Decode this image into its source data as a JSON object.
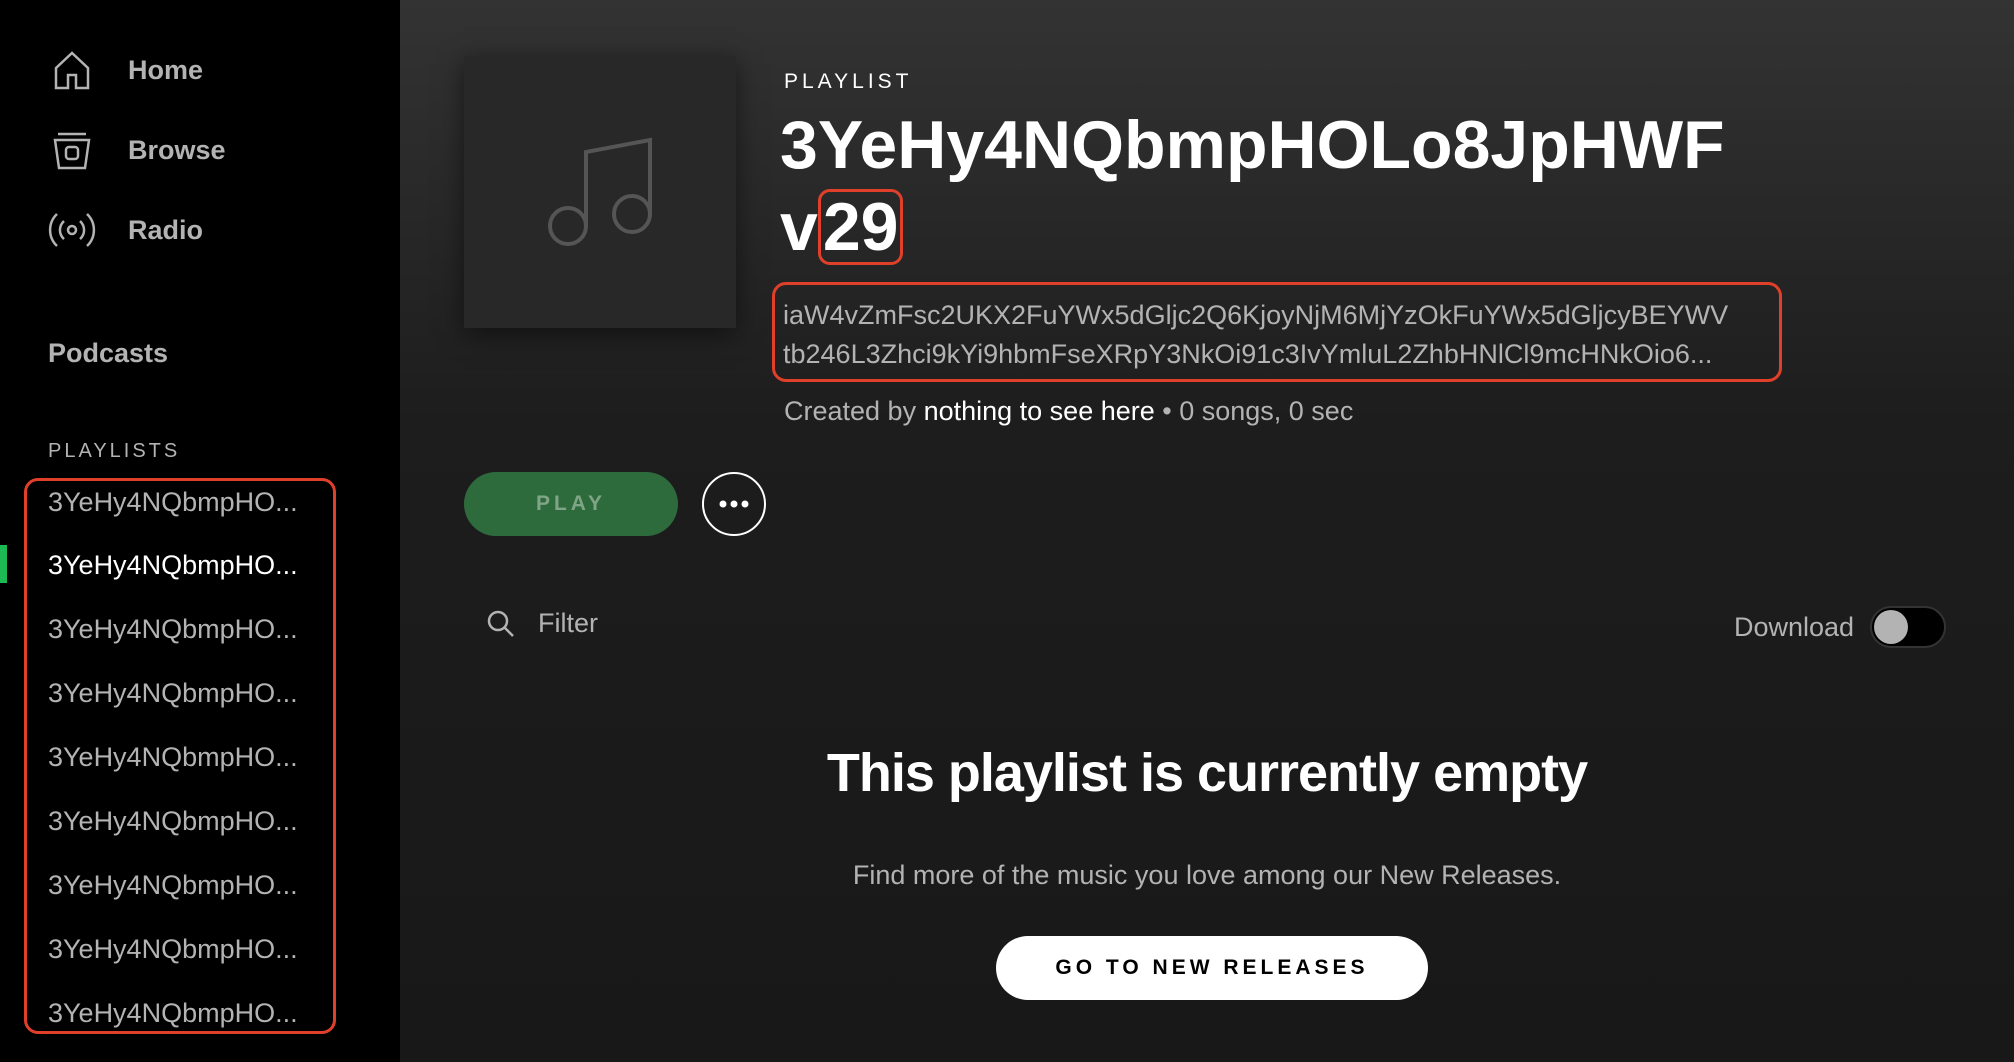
{
  "sidebar": {
    "nav": [
      {
        "label": "Home",
        "icon": "home-icon"
      },
      {
        "label": "Browse",
        "icon": "browse-icon"
      },
      {
        "label": "Radio",
        "icon": "radio-icon"
      }
    ],
    "podcasts_label": "Podcasts",
    "playlists_header": "PLAYLISTS",
    "playlists": [
      {
        "label": "3YeHy4NQbmpHO..."
      },
      {
        "label": "3YeHy4NQbmpHO..."
      },
      {
        "label": "3YeHy4NQbmpHO..."
      },
      {
        "label": "3YeHy4NQbmpHO..."
      },
      {
        "label": "3YeHy4NQbmpHO..."
      },
      {
        "label": "3YeHy4NQbmpHO..."
      },
      {
        "label": "3YeHy4NQbmpHO..."
      },
      {
        "label": "3YeHy4NQbmpHO..."
      },
      {
        "label": "3YeHy4NQbmpHO..."
      }
    ],
    "active_playlist_index": 1
  },
  "header": {
    "type_label": "PLAYLIST",
    "title_line1": "3YeHy4NQbmpHOLo8JpHWF",
    "title_prefix": "v",
    "title_version": "29",
    "description_line1": "iaW4vZmFsc2UKX2FuYWx5dGljc2Q6KjoyNjM6MjYzOkFuYWx5dGljcyBEYWV",
    "description_line2": "tb246L3Zhci9kYi9hbmFseXRpY3NkOi91c3IvYmluL2ZhbHNlCl9mcHNkOio6...",
    "meta_prefix": "Created by ",
    "meta_owner": "nothing to see here",
    "meta_suffix": " • 0 songs, 0 sec"
  },
  "actions": {
    "play_label": "PLAY",
    "more_icon": "more-icon"
  },
  "filter": {
    "placeholder": "Filter",
    "icon": "search-icon"
  },
  "download": {
    "label": "Download",
    "enabled": false
  },
  "empty_state": {
    "title": "This playlist is currently empty",
    "subtitle": "Find more of the music you love among our New Releases.",
    "button_label": "GO TO NEW RELEASES"
  },
  "colors": {
    "accent": "#1db954",
    "highlight_outline": "#e0402a"
  }
}
